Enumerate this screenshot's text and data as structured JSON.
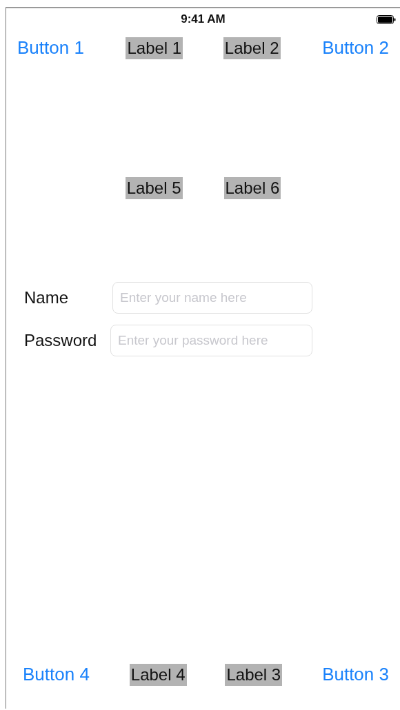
{
  "status_bar": {
    "time": "9:41 AM"
  },
  "top_row": [
    {
      "kind": "button",
      "text": "Button 1"
    },
    {
      "kind": "label",
      "text": "Label 1"
    },
    {
      "kind": "label",
      "text": "Label 2"
    },
    {
      "kind": "button",
      "text": "Button 2"
    }
  ],
  "middle_row": [
    {
      "kind": "label",
      "text": "Label 5"
    },
    {
      "kind": "label",
      "text": "Label 6"
    }
  ],
  "form": [
    {
      "label": "Name",
      "placeholder": "Enter your name here"
    },
    {
      "label": "Password",
      "placeholder": "Enter your password here"
    }
  ],
  "bottom_row": [
    {
      "kind": "button",
      "text": "Button 4"
    },
    {
      "kind": "label",
      "text": "Label 4"
    },
    {
      "kind": "label",
      "text": "Label 3"
    },
    {
      "kind": "button",
      "text": "Button 3"
    }
  ]
}
